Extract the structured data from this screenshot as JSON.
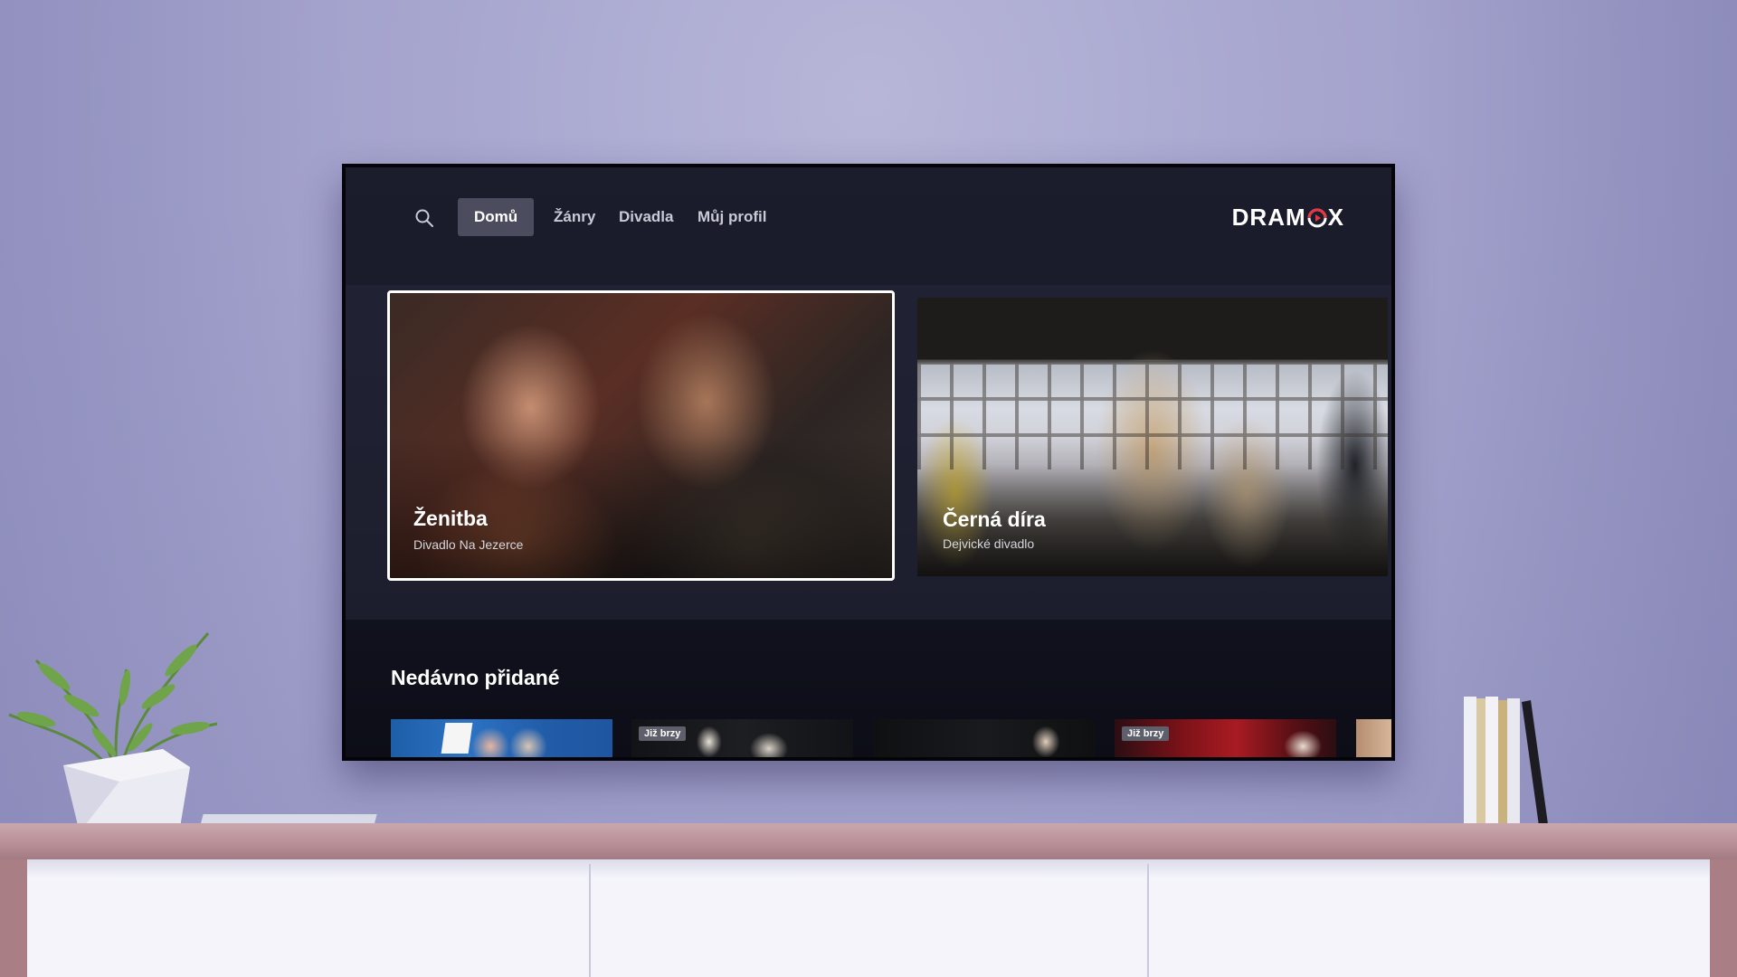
{
  "brand": {
    "logo_text_left": "DRAM",
    "logo_text_right": "X",
    "accent_color": "#e8343d"
  },
  "nav": {
    "items": [
      {
        "label": "Domů",
        "active": true
      },
      {
        "label": "Žánry",
        "active": false
      },
      {
        "label": "Divadla",
        "active": false
      },
      {
        "label": "Můj profil",
        "active": false
      }
    ]
  },
  "hero": {
    "cards": [
      {
        "title": "Ženitba",
        "subtitle": "Divadlo Na Jezerce",
        "focused": true
      },
      {
        "title": "Černá díra",
        "subtitle": "Dejvické divadlo",
        "focused": false
      }
    ]
  },
  "recent": {
    "title": "Nedávno přidané",
    "items": [
      {
        "badge": ""
      },
      {
        "badge": "Již brzy"
      },
      {
        "badge": ""
      },
      {
        "badge": "Již brzy"
      },
      {
        "badge": ""
      }
    ]
  }
}
